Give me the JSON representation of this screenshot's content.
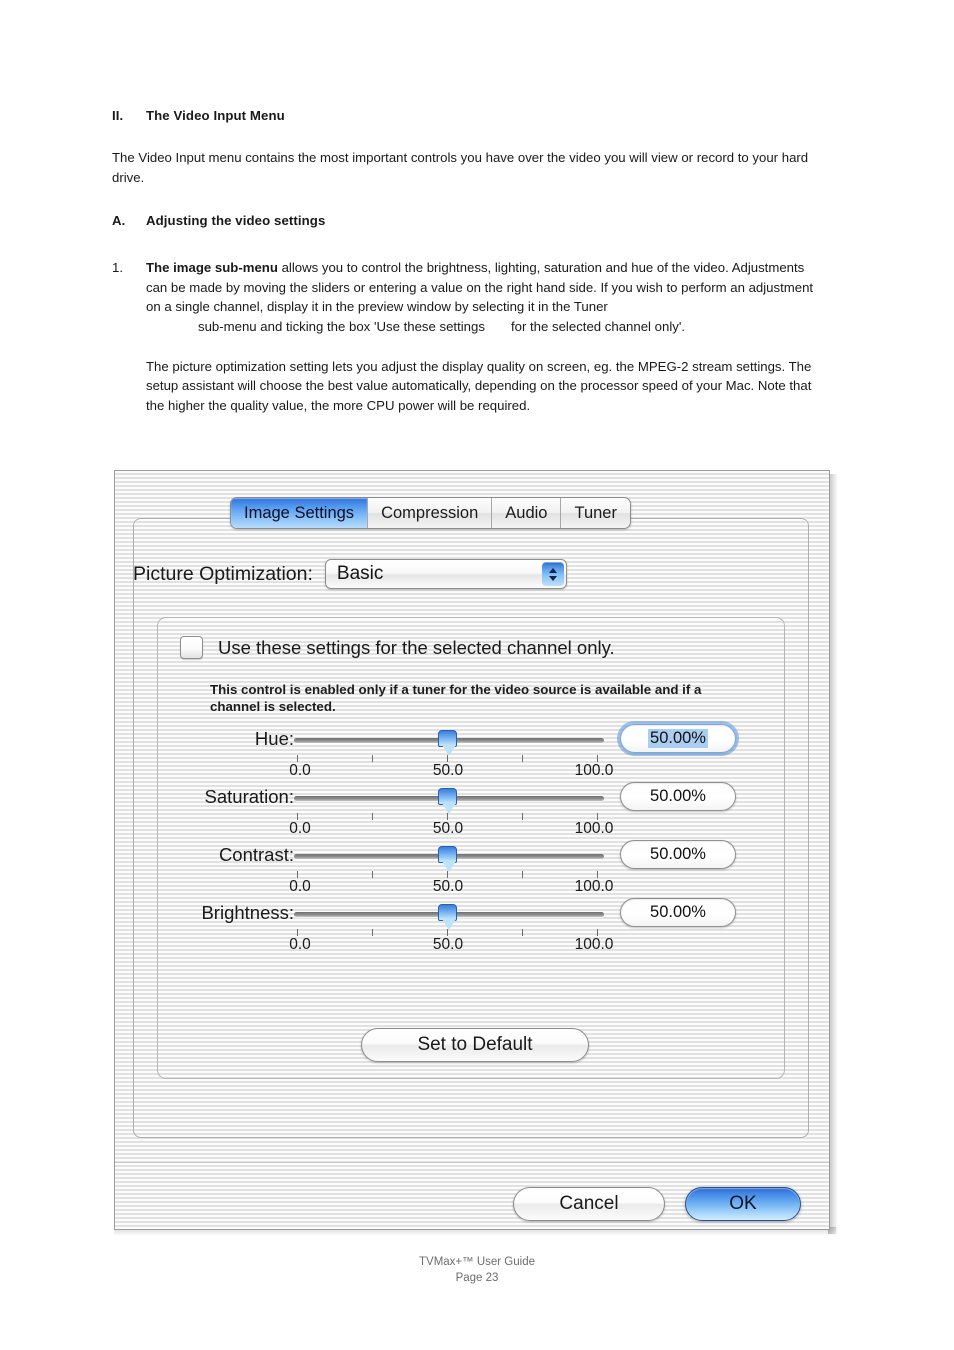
{
  "document": {
    "section": {
      "number": "II.",
      "title": "The Video Input Menu"
    },
    "intro": "The Video Input menu contains the most important controls you have over the video you will view or record to your hard drive.",
    "subsection": {
      "letter": "A.",
      "title": "Adjusting the video settings"
    },
    "item1": {
      "number": "1.",
      "bold_lead": "The image sub-menu",
      "text_part1": " allows you to control the brightness, lighting, saturation and hue of the video. Adjustments can be made by moving the sliders or entering a value on the right hand side. If you wish to perform an adjustment on a single channel, display it in the preview window by selecting it in the Tuner",
      "text_indented_a": "sub-menu and ticking the box 'Use these settings",
      "text_indented_b": "for the selected channel only'."
    },
    "para2": "The picture optimization setting lets you adjust the display quality on screen, eg. the MPEG-2 stream settings. The setup assistant will choose the best value automatically, depending on the processor speed of your Mac. Note that the higher the quality value, the more CPU power will be required."
  },
  "dialog": {
    "tabs": [
      {
        "label": "Image Settings",
        "active": true
      },
      {
        "label": "Compression",
        "active": false
      },
      {
        "label": "Audio",
        "active": false
      },
      {
        "label": "Tuner",
        "active": false
      }
    ],
    "picture_optimization": {
      "label": "Picture Optimization:",
      "value": "Basic"
    },
    "channel_checkbox": {
      "label": "Use these settings for the selected channel only.",
      "checked": false
    },
    "note": "This control is enabled only if a tuner for the video source is available and if a channel is selected.",
    "sliders": [
      {
        "label": "Hue:",
        "value": "50.00%",
        "position": 50,
        "focused": true,
        "scale": [
          "0.0",
          "50.0",
          "100.0"
        ]
      },
      {
        "label": "Saturation:",
        "value": "50.00%",
        "position": 50,
        "focused": false,
        "scale": [
          "0.0",
          "50.0",
          "100.0"
        ]
      },
      {
        "label": "Contrast:",
        "value": "50.00%",
        "position": 50,
        "focused": false,
        "scale": [
          "0.0",
          "50.0",
          "100.0"
        ]
      },
      {
        "label": "Brightness:",
        "value": "50.00%",
        "position": 50,
        "focused": false,
        "scale": [
          "0.0",
          "50.0",
          "100.0"
        ]
      }
    ],
    "set_to_default_label": "Set to Default",
    "cancel_label": "Cancel",
    "ok_label": "OK",
    "colors": {
      "accent_blue": "#3f86e8",
      "tab_active_blue": "#2f6fd8",
      "focus_ring": "#6aa0e0",
      "selection_highlight": "#aacdf2",
      "window_bg": "#e9e9e9"
    }
  },
  "footer": {
    "line1": "TVMax+™ User Guide",
    "line2": "Page 23"
  }
}
